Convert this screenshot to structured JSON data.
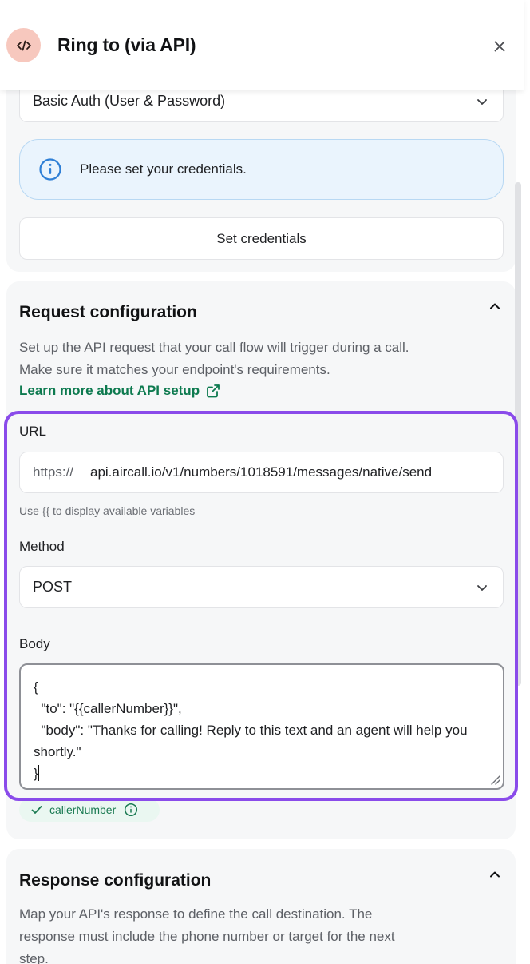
{
  "header": {
    "title": "Ring to (via API)",
    "badge_icon": "code-icon",
    "close_icon": "close-icon"
  },
  "auth": {
    "selected_method": "Basic Auth (User & Password)",
    "info_text": "Please set your credentials.",
    "set_credentials_label": "Set credentials"
  },
  "request": {
    "title": "Request configuration",
    "description": "Set up the API request that your call flow will trigger during a call. Make sure it matches your endpoint's requirements.",
    "learn_more": "Learn more about API setup",
    "url_label": "URL",
    "url_prefix": "https://",
    "url_value": "api.aircall.io/v1/numbers/1018591/messages/native/send",
    "hint": "Use {{ to display available variables",
    "method_label": "Method",
    "method_value": "POST",
    "body_label": "Body",
    "body_value": "{\n  \"to\": \"{{callerNumber}}\",\n  \"body\": \"Thanks for calling! Reply to this text and an agent will help you shortly.\"\n}",
    "variable_chip": "callerNumber"
  },
  "response": {
    "title": "Response configuration",
    "description": "Map your API's response to define the call destination. The response must include the phone number or target for the next step."
  },
  "colors": {
    "accent_purple": "#8a4bea",
    "link_green": "#0d7a4f",
    "info_blue": "#2f7fd6",
    "badge_bg": "#f7c8be"
  }
}
